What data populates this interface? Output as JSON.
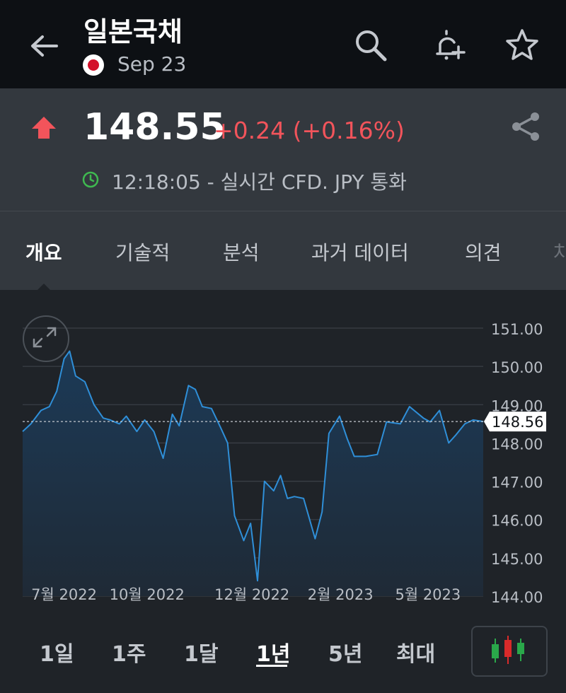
{
  "header": {
    "title": "일본국채",
    "date": "Sep 23"
  },
  "quote": {
    "price": "148.55",
    "change": "+0.24 (+0.16%)",
    "status": "12:18:05 - 실시간 CFD. JPY 통화",
    "direction": "up",
    "up_color": "#f2545b"
  },
  "tabs": [
    {
      "label": "개요",
      "active": true
    },
    {
      "label": "기술적",
      "active": false
    },
    {
      "label": "분석",
      "active": false
    },
    {
      "label": "과거 데이터",
      "active": false
    },
    {
      "label": "의견",
      "active": false
    },
    {
      "label": "차",
      "active": false
    }
  ],
  "ranges": [
    {
      "label": "1일",
      "active": false
    },
    {
      "label": "1주",
      "active": false
    },
    {
      "label": "1달",
      "active": false
    },
    {
      "label": "1년",
      "active": true
    },
    {
      "label": "5년",
      "active": false
    },
    {
      "label": "최대",
      "active": false
    }
  ],
  "chart_data": {
    "type": "area",
    "current_value_label": "148.56",
    "current_value": 148.56,
    "ylim": [
      144.0,
      151.0
    ],
    "yticks": [
      "151.00",
      "150.00",
      "149.00",
      "148.00",
      "147.00",
      "146.00",
      "145.00",
      "144.00"
    ],
    "xticks": [
      {
        "label": "7월 2022",
        "t": 0.09
      },
      {
        "label": "10월 2022",
        "t": 0.27
      },
      {
        "label": "12월 2022",
        "t": 0.498
      },
      {
        "label": "2월 2023",
        "t": 0.69
      },
      {
        "label": "5월 2023",
        "t": 0.88
      }
    ],
    "series": [
      {
        "t": [
          0.0,
          0.018,
          0.04,
          0.058,
          0.074,
          0.09,
          0.102,
          0.115,
          0.135,
          0.155,
          0.175,
          0.19,
          0.21,
          0.225,
          0.248,
          0.265,
          0.285,
          0.305,
          0.325,
          0.34,
          0.36,
          0.375,
          0.39,
          0.41,
          0.43,
          0.445,
          0.46,
          0.48,
          0.495,
          0.51,
          0.525,
          0.545,
          0.56,
          0.575,
          0.59,
          0.61,
          0.635,
          0.65,
          0.665,
          0.688,
          0.705,
          0.72,
          0.745,
          0.77,
          0.79,
          0.82,
          0.84,
          0.87,
          0.885,
          0.905,
          0.925,
          0.94,
          0.96,
          0.978,
          1.0
        ],
        "y": [
          148.3,
          148.5,
          148.85,
          148.95,
          149.35,
          150.2,
          150.4,
          149.75,
          149.6,
          149.0,
          148.65,
          148.6,
          148.5,
          148.7,
          148.3,
          148.6,
          148.3,
          147.6,
          148.75,
          148.45,
          149.5,
          149.4,
          148.95,
          148.9,
          148.4,
          148.0,
          146.1,
          145.45,
          145.9,
          144.4,
          147.0,
          146.75,
          147.15,
          146.55,
          146.6,
          146.55,
          145.5,
          146.2,
          148.25,
          148.7,
          148.1,
          147.65,
          147.65,
          147.7,
          148.55,
          148.5,
          148.95,
          148.65,
          148.55,
          148.85,
          148.0,
          148.2,
          148.5,
          148.6,
          148.56
        ]
      }
    ],
    "line_color": "#2f8fd8",
    "fill_top": "#1c3a57",
    "fill_bottom": "#1f2a36",
    "label_box_color": "#ffffff"
  }
}
